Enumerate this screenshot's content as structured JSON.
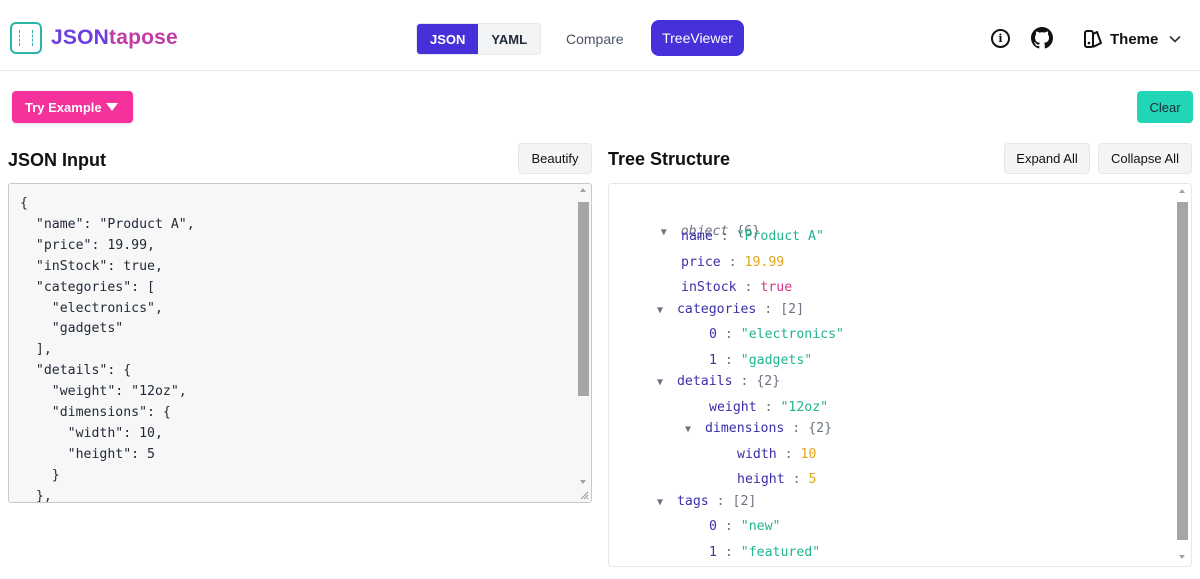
{
  "app": {
    "name_part1": "JSON",
    "name_part2": "tapose"
  },
  "header": {
    "formats": [
      "JSON",
      "YAML"
    ],
    "compare_label": "Compare",
    "treeviewer_label": "TreeViewer",
    "theme_label": "Theme"
  },
  "toolbar": {
    "try_example_label": "Try Example",
    "clear_label": "Clear"
  },
  "left": {
    "title": "JSON Input",
    "beautify_label": "Beautify",
    "text": "{\n  \"name\": \"Product A\",\n  \"price\": 19.99,\n  \"inStock\": true,\n  \"categories\": [\n    \"electronics\",\n    \"gadgets\"\n  ],\n  \"details\": {\n    \"weight\": \"12oz\",\n    \"dimensions\": {\n      \"width\": 10,\n      \"height\": 5\n    }\n  },"
  },
  "right": {
    "title": "Tree Structure",
    "expand_label": "Expand All",
    "collapse_label": "Collapse All",
    "root": {
      "label": "object",
      "count": "{6}"
    },
    "rows": [
      {
        "key": "name",
        "value": "\"Product A\"",
        "kind": "str"
      },
      {
        "key": "price",
        "value": "19.99",
        "kind": "num"
      },
      {
        "key": "inStock",
        "value": "true",
        "kind": "bool"
      },
      {
        "key": "categories",
        "value": "[2]",
        "kind": "meta"
      },
      {
        "key": "0",
        "value": "\"electronics\"",
        "kind": "str"
      },
      {
        "key": "1",
        "value": "\"gadgets\"",
        "kind": "str"
      },
      {
        "key": "details",
        "value": "{2}",
        "kind": "meta"
      },
      {
        "key": "weight",
        "value": "\"12oz\"",
        "kind": "str"
      },
      {
        "key": "dimensions",
        "value": "{2}",
        "kind": "meta"
      },
      {
        "key": "width",
        "value": "10",
        "kind": "num"
      },
      {
        "key": "height",
        "value": "5",
        "kind": "num"
      },
      {
        "key": "tags",
        "value": "[2]",
        "kind": "meta"
      },
      {
        "key": "0",
        "value": "\"new\"",
        "kind": "str"
      },
      {
        "key": "1",
        "value": "\"featured\"",
        "kind": "str"
      }
    ]
  },
  "colors": {
    "primary": "#4530d9",
    "pink": "#f5319b",
    "teal": "#21d5b7"
  }
}
